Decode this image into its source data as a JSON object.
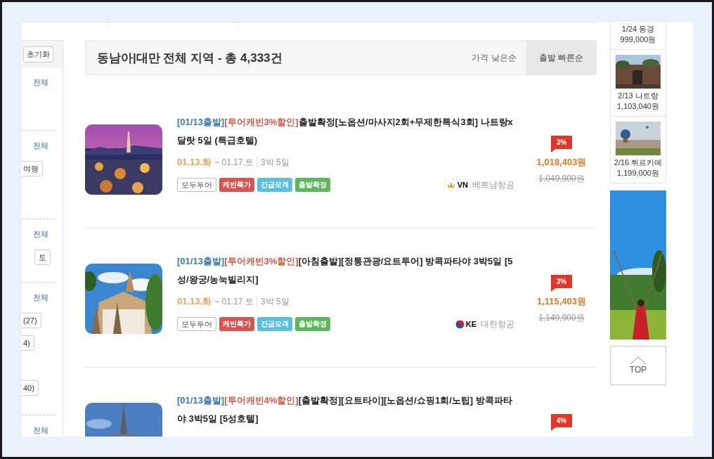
{
  "sidebar": {
    "reset_button": "초기화",
    "sections": [
      {
        "link": "전체"
      },
      {
        "link": "전체",
        "chips": [
          "여행"
        ]
      },
      {
        "link": "전체",
        "chips": [
          "토"
        ]
      },
      {
        "link": "전체",
        "chips": [
          "(27)",
          "4)",
          "40)"
        ]
      },
      {
        "link": "전체"
      }
    ]
  },
  "header": {
    "title": "동남아|대만 전체 지역 - 총 4,333건",
    "sort_options": [
      {
        "label": "가격 낮은순",
        "selected": false
      },
      {
        "label": "출발 빠른순",
        "selected": true
      }
    ]
  },
  "products": [
    {
      "departure_tag": "[01/13출발]",
      "discount_tag": "[투어캐빈3%할인]",
      "name": "출발확정[노옵션/마사지2회+무제한특식3회] 나트랑x 달랏 5일 (특급호텔)",
      "start": "01.13.화",
      "end": "~ 01.17.토",
      "duration": "3박 5일",
      "tags": [
        {
          "label": "모두투어",
          "kind": "outline"
        },
        {
          "label": "캐빈특가",
          "kind": "filled",
          "color": "#d9534f"
        },
        {
          "label": "긴급모객",
          "kind": "filled",
          "color": "#5bc0de"
        },
        {
          "label": "출발확정",
          "kind": "filled",
          "color": "#5cb85c"
        }
      ],
      "airline": {
        "kind": "lotus",
        "code": "VN",
        "name": "베트남항공"
      },
      "badge": "3%",
      "price": "1,018,403원",
      "original_price": "1,049,900원"
    },
    {
      "departure_tag": "[01/13출발]",
      "discount_tag": "[투어캐빈3%할인]",
      "name": "[아침출발][정통관광/요트투어] 방콕파타야 3박5일 [5성/왕궁/농눅빌리지]",
      "start": "01.13.화",
      "end": "~ 01.17.토",
      "duration": "3박 5일",
      "tags": [
        {
          "label": "모두투어",
          "kind": "outline"
        },
        {
          "label": "캐빈특가",
          "kind": "filled",
          "color": "#d9534f"
        },
        {
          "label": "긴급모객",
          "kind": "filled",
          "color": "#5bc0de"
        },
        {
          "label": "출발확정",
          "kind": "filled",
          "color": "#5cb85c"
        }
      ],
      "airline": {
        "kind": "taeguk",
        "code": "KE",
        "name": "대한항공"
      },
      "badge": "3%",
      "price": "1,115,403원",
      "original_price": "1,149,900원"
    },
    {
      "departure_tag": "[01/13출발]",
      "discount_tag": "[투어캐빈4%할인]",
      "name": "[출발확정][요트타이][노옵션/쇼핑1회/노팁] 방콕파타야 3박5일 [5성호텔]",
      "badge": "4%"
    }
  ],
  "recent_items": [
    {
      "kind": "plain",
      "label": "1/24 동경",
      "price": "999,000원"
    },
    {
      "kind": "picture",
      "label": "2/13 나트랑",
      "price": "1,103,040원"
    },
    {
      "kind": "picture",
      "label": "2/16 튀르키예",
      "price": "1,199,000원"
    }
  ],
  "top_button": "TOP"
}
